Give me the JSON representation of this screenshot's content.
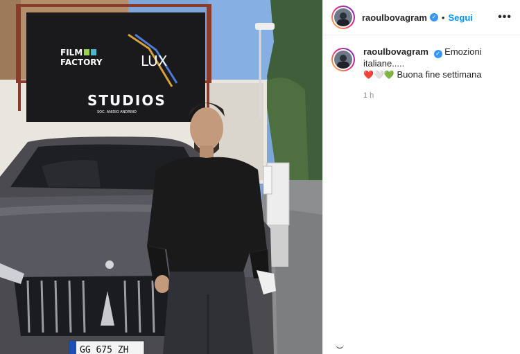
{
  "post": {
    "username": "raoulbovagram",
    "verified_symbol": "✓",
    "separator": "•",
    "follow_label": "Segui",
    "more_icon": "•••",
    "caption_title": "Emozioni italiane.....",
    "caption_hearts": [
      "❤️",
      "🤍",
      "💚"
    ],
    "caption_body": "Buona fine settimana",
    "timestamp": "1 h"
  },
  "photo": {
    "billboard_brand_left_1": "FILM",
    "billboard_brand_left_2": "FACTORY",
    "billboard_brand_right": "LUX",
    "billboard_main": "STUDIOS",
    "billboard_sub": "SOC. ANIDIO ANDRINO",
    "license_plate": "GG 675 ZH"
  },
  "colors": {
    "link_blue": "#0095f6",
    "verified_blue": "#3897f0",
    "muted_gray": "#8e8e8e"
  }
}
